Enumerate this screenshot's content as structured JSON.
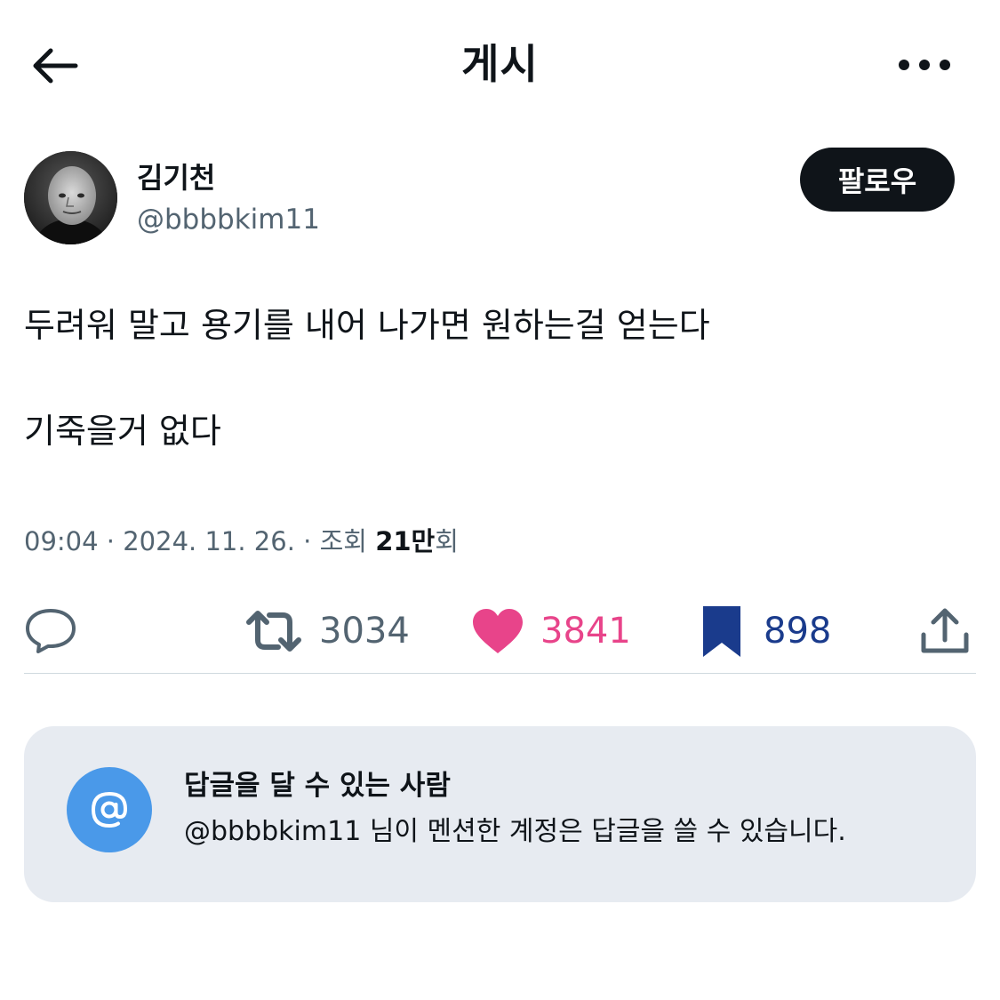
{
  "header": {
    "title": "게시",
    "back_icon": "arrow-left-icon",
    "more_icon": "more-horizontal-icon"
  },
  "author": {
    "name": "김기천",
    "handle": "@bbbbkim11",
    "follow_label": "팔로우"
  },
  "post": {
    "lines": [
      "두려워 말고 용기를 내어 나가면 원하는걸 얻는다",
      "기죽을거 없다"
    ]
  },
  "meta": {
    "time": "09:04",
    "separator": " · ",
    "date": "2024. 11. 26.",
    "views_label": "조회",
    "views_number": "21만",
    "views_suffix": "회"
  },
  "actions": {
    "reply_icon": "reply-bubble-icon",
    "retweet_icon": "retweet-icon",
    "retweet_count": "3034",
    "like_icon": "heart-filled-icon",
    "like_count": "3841",
    "bookmark_icon": "bookmark-filled-icon",
    "bookmark_count": "898",
    "share_icon": "share-icon"
  },
  "reply_restriction": {
    "icon": "at",
    "title": "답글을 달 수 있는 사람",
    "description": "@bbbbkim11 님이 멘션한 계정은 답글을 쓸 수 있습니다."
  },
  "colors": {
    "text": "#0f1419",
    "secondary": "#536471",
    "like": "#e8448a",
    "bookmark": "#1a3b8c",
    "at_circle": "#4a99e9",
    "reply_box": "#e7ebf1"
  }
}
